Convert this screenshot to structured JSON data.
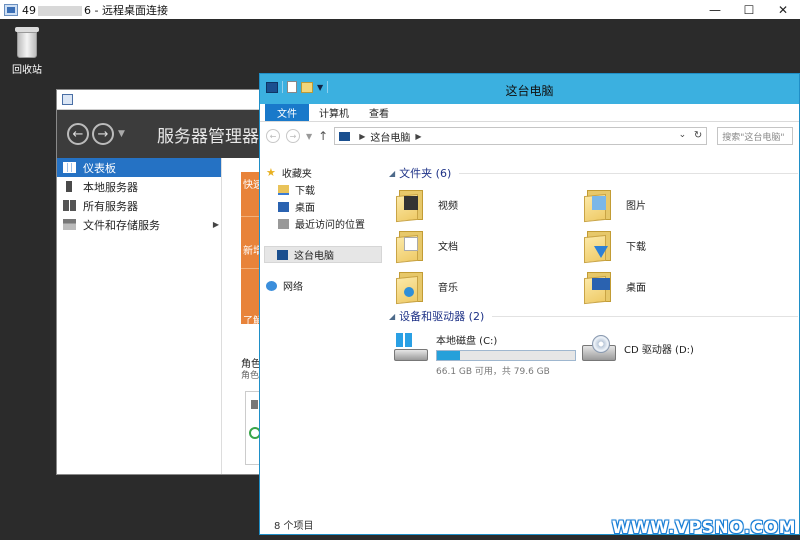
{
  "rdp": {
    "title_prefix": "49",
    "title_suffix": "6 - 远程桌面连接",
    "minimize": "—",
    "maximize": "☐",
    "close": "✕"
  },
  "desktop": {
    "recycle_bin_label": "回收站"
  },
  "server_manager": {
    "header_title": "服务器管理器",
    "nav": [
      {
        "label": "仪表板",
        "active": true
      },
      {
        "label": "本地服务器",
        "active": false
      },
      {
        "label": "所有服务器",
        "active": false
      },
      {
        "label": "文件和存储服务",
        "active": false
      }
    ],
    "orange_texts": [
      "快速",
      "新增",
      "了解"
    ],
    "roles_heading": "角色",
    "roles_sub": "角色"
  },
  "explorer": {
    "title": "这台电脑",
    "ribbon_tabs": [
      "文件",
      "计算机",
      "查看"
    ],
    "address": "这台电脑",
    "search_placeholder": "搜索\"这台电脑\"",
    "nav_pane": {
      "favorites": "收藏夹",
      "downloads": "下载",
      "desktop": "桌面",
      "recent": "最近访问的位置",
      "this_pc": "这台电脑",
      "network": "网络"
    },
    "folders_group": "文件夹 (6)",
    "folders": [
      {
        "label": "视频",
        "icon": "video-folder-icon"
      },
      {
        "label": "图片",
        "icon": "pictures-folder-icon"
      },
      {
        "label": "文档",
        "icon": "documents-folder-icon"
      },
      {
        "label": "下载",
        "icon": "downloads-folder-icon"
      },
      {
        "label": "音乐",
        "icon": "music-folder-icon"
      },
      {
        "label": "桌面",
        "icon": "desktop-folder-icon"
      }
    ],
    "devices_group": "设备和驱动器 (2)",
    "drives": [
      {
        "label": "本地磁盘 (C:)",
        "free_text": "66.1 GB 可用，共 79.6 GB",
        "used_fraction": 0.17
      },
      {
        "label": "CD 驱动器 (D:)"
      }
    ],
    "status": "8 个项目"
  },
  "watermark": "WWW.VPSNO.COM",
  "colors": {
    "titlebar_accent": "#3bb0e0",
    "file_tab": "#1979ca",
    "selection_blue": "#2572c4",
    "orange_tile": "#e8833a",
    "group_title": "#1e3287"
  }
}
